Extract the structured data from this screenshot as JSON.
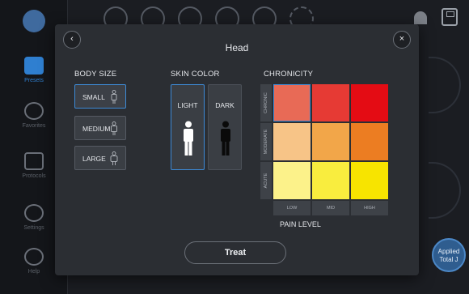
{
  "sidebar": {
    "items": [
      {
        "label": "Presets"
      },
      {
        "label": "Favorites"
      },
      {
        "label": "Protocols"
      },
      {
        "label": "Settings"
      },
      {
        "label": "Help"
      }
    ]
  },
  "applied_badge": {
    "line1": "Applied",
    "line2": "Total J"
  },
  "modal": {
    "title": "Head",
    "body_size": {
      "title": "BODY SIZE",
      "options": [
        "SMALL",
        "MEDIUM",
        "LARGE"
      ],
      "selected": "SMALL"
    },
    "skin_color": {
      "title": "SKIN COLOR",
      "options": [
        "LIGHT",
        "DARK"
      ],
      "selected": "LIGHT"
    },
    "chronicity": {
      "title": "CHRONICITY",
      "rows": [
        "CHRONIC",
        "MODERATE",
        "ACUTE"
      ],
      "columns": [
        "LOW",
        "MID",
        "HIGH"
      ],
      "colors": [
        [
          "#e86a56",
          "#e63a34",
          "#e40c14"
        ],
        [
          "#f7c487",
          "#f2a649",
          "#ec7d22"
        ],
        [
          "#fcf28a",
          "#f9ed3e",
          "#f7e400"
        ]
      ],
      "selected_cell": "CHRONIC-LOW",
      "pain_level_label": "PAIN LEVEL"
    },
    "treat_label": "Treat"
  },
  "colors": {
    "accent": "#3d8ad6",
    "modal_bg": "#2b2e33",
    "app_bg": "#1b1d22"
  }
}
